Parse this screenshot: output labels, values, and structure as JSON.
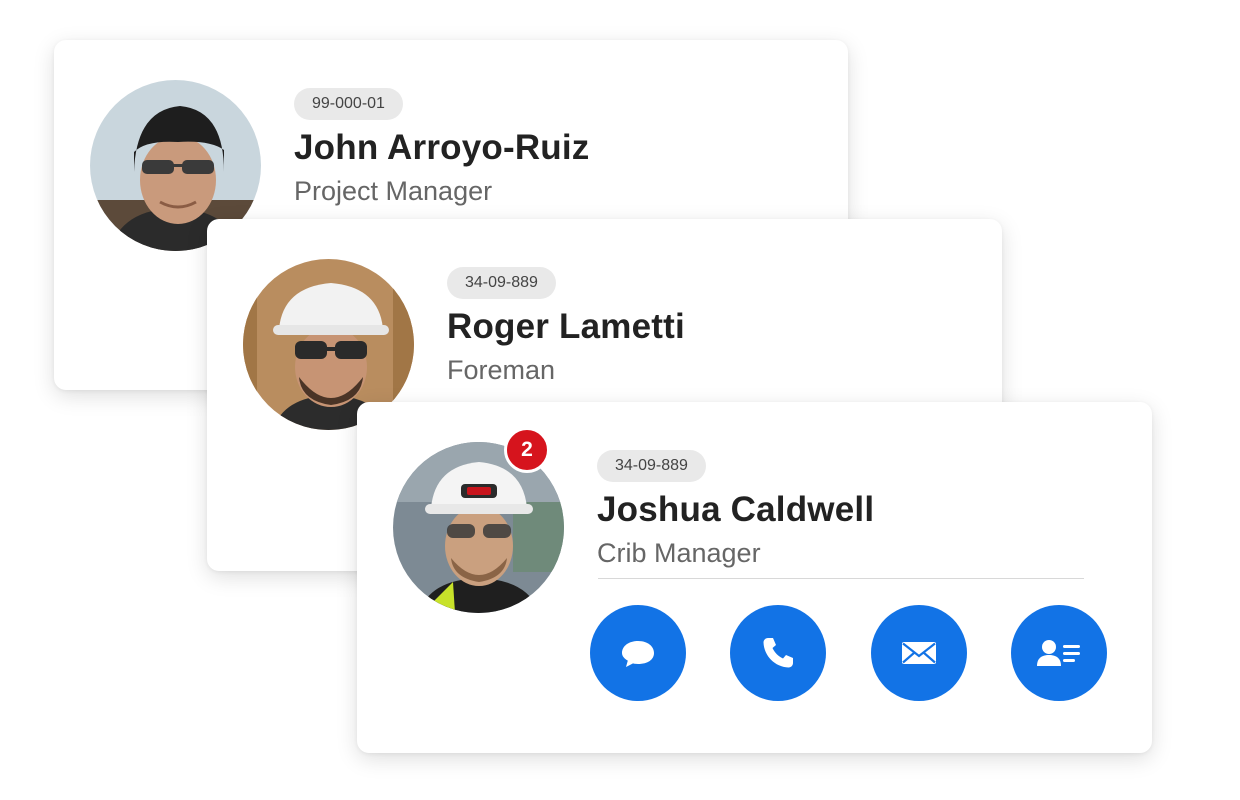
{
  "colors": {
    "action_blue": "#1273e6",
    "badge_red": "#d6141d",
    "id_pill_bg": "#e9e9e9",
    "name_text": "#222222",
    "role_text": "#666666"
  },
  "contacts": [
    {
      "employee_id": "99-000-01",
      "name": "John Arroyo-Ruiz",
      "role": "Project Manager",
      "avatar": "photo-worker-beanie-sunglasses"
    },
    {
      "employee_id": "34-09-889",
      "name": "Roger Lametti",
      "role": "Foreman",
      "avatar": "photo-worker-white-hardhat-goggles"
    },
    {
      "employee_id": "34-09-889",
      "name": "Joshua Caldwell",
      "role": "Crib Manager",
      "avatar": "photo-worker-hardhat-headlamp",
      "notification_count": "2",
      "actions": [
        {
          "icon": "chat-bubble-icon"
        },
        {
          "icon": "phone-icon"
        },
        {
          "icon": "envelope-icon"
        },
        {
          "icon": "contact-card-icon"
        }
      ]
    }
  ]
}
